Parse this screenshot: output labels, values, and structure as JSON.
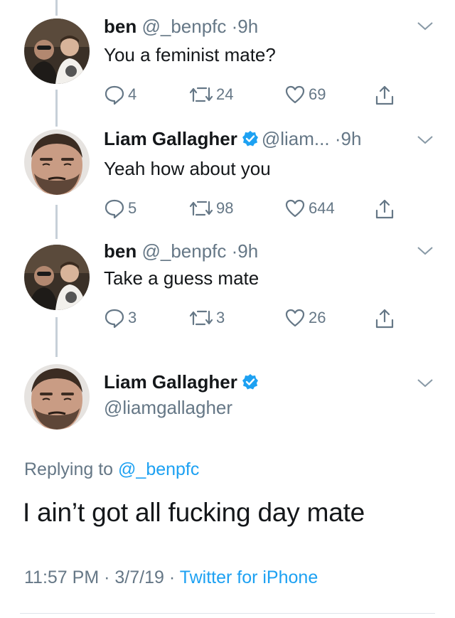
{
  "tweets": [
    {
      "name": "ben",
      "handle": "@_benpfc",
      "dot": "·",
      "time": "9h",
      "text": "You a feminist mate?",
      "replies": "4",
      "retweets": "24",
      "likes": "69"
    },
    {
      "name": "Liam Gallagher",
      "handle": "@liam...",
      "dot": "·",
      "time": "9h",
      "text": "Yeah how about you",
      "replies": "5",
      "retweets": "98",
      "likes": "644"
    },
    {
      "name": "ben",
      "handle": "@_benpfc",
      "dot": "·",
      "time": "9h",
      "text": "Take a guess mate",
      "replies": "3",
      "retweets": "3",
      "likes": "26"
    }
  ],
  "main": {
    "name": "Liam Gallagher",
    "handle": "@liamgallagher",
    "replying_prefix": "Replying to",
    "replying_to": "@_benpfc",
    "text": "I ain’t got all fucking day mate",
    "time": "11:57 PM",
    "date": "3/7/19",
    "sep": "·",
    "source": "Twitter for iPhone"
  },
  "icons": {
    "reply": "reply-icon",
    "retweet": "retweet-icon",
    "like": "heart-icon",
    "share": "share-icon",
    "verified": "verified-badge-icon",
    "menu": "chevron-down-icon"
  },
  "colors": {
    "accent": "#1da1f2",
    "muted": "#657786",
    "text": "#14171a",
    "thread_line": "#c7d0d8"
  }
}
